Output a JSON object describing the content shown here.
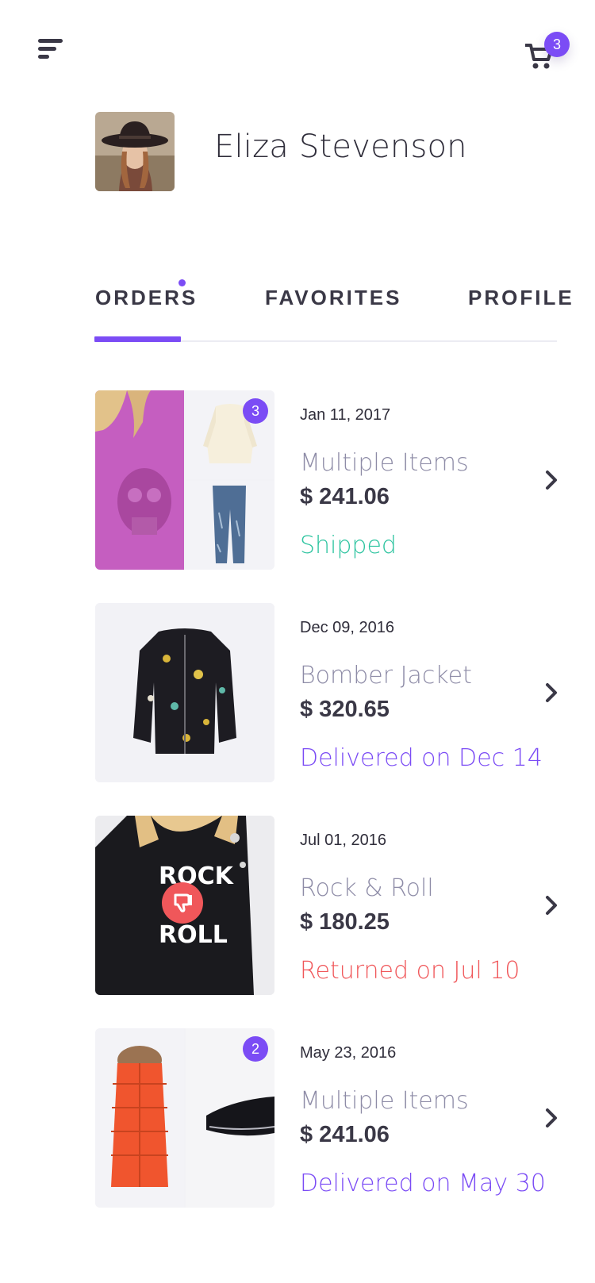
{
  "header": {
    "menu_icon": "hamburger-menu-icon",
    "cart_icon": "shopping-cart-icon",
    "cart_count": "3",
    "accent_color": "#7b4cf5"
  },
  "user": {
    "name": "Eliza Stevenson",
    "avatar_icon": "user-avatar-photo"
  },
  "tabs": [
    {
      "label": "ORDERS",
      "active": true,
      "has_notification": true
    },
    {
      "label": "FAVORITES",
      "active": false
    },
    {
      "label": "PROFILE",
      "active": false
    }
  ],
  "orders": [
    {
      "date": "Jan 11, 2017",
      "title": "Multiple Items",
      "price": "$ 241.06",
      "status": "Shipped",
      "status_color": "#2ec4a0",
      "item_count": "3"
    },
    {
      "date": "Dec 09, 2016",
      "title": "Bomber Jacket",
      "price": "$ 320.65",
      "status": "Delivered on Dec 14",
      "status_color": "#7b4cf5"
    },
    {
      "date": "Jul 01, 2016",
      "title": "Rock & Roll",
      "price": "$ 180.25",
      "status": "Returned on Jul 10",
      "status_color": "#f0575a",
      "thumbnail_text_line1": "ROCK",
      "thumbnail_text_line2": "ROLL"
    },
    {
      "date": "May 23, 2016",
      "title": "Multiple Items",
      "price": "$ 241.06",
      "status": "Delivered on May 30",
      "status_color": "#7b4cf5",
      "item_count": "2"
    }
  ]
}
